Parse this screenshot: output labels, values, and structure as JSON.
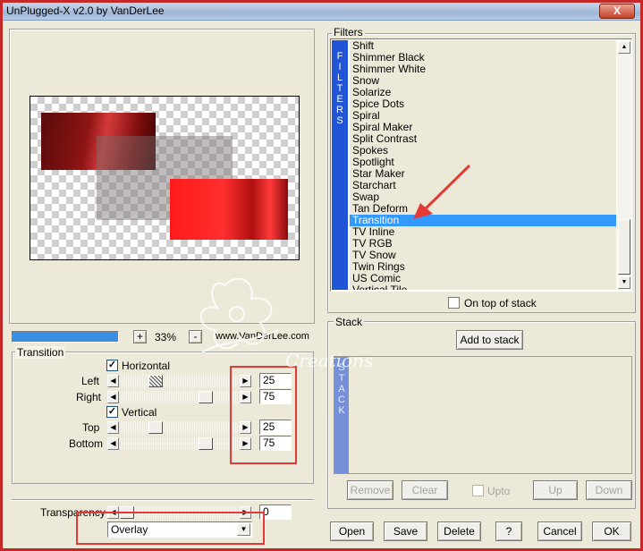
{
  "window": {
    "title": "UnPlugged-X v2.0 by VanDerLee",
    "close_label": "X"
  },
  "preview": {
    "progress": 1.0,
    "zoom_value": "33%",
    "plus_label": "+",
    "minus_label": "-",
    "website": "www.VanDerLee.com"
  },
  "filters": {
    "group_title": "Filters",
    "band_label": "FILTERS",
    "items": [
      "Shift",
      "Shimmer Black",
      "Shimmer White",
      "Snow",
      "Solarize",
      "Spice Dots",
      "Spiral",
      "Spiral Maker",
      "Split Contrast",
      "Spokes",
      "Spotlight",
      "Star Maker",
      "Starchart",
      "Swap",
      "Tan Deform",
      "Transition",
      "TV Inline",
      "TV RGB",
      "TV Snow",
      "Twin Rings",
      "US Comic",
      "Vertical Tile"
    ],
    "selected": "Transition",
    "on_top_label": "On top of stack"
  },
  "stack": {
    "group_title": "Stack",
    "add_label": "Add to stack",
    "band_label": "STACK",
    "remove_label": "Remove",
    "clear_label": "Clear",
    "upto_label": "Upto",
    "up_label": "Up",
    "down_label": "Down"
  },
  "transition": {
    "group_title": "Transition",
    "horizontal_label": "Horizontal",
    "vertical_label": "Vertical",
    "left_label": "Left",
    "left_value": "25",
    "right_label": "Right",
    "right_value": "75",
    "top_label": "Top",
    "top_value": "25",
    "bottom_label": "Bottom",
    "bottom_value": "75"
  },
  "transparency": {
    "label": "Transparency",
    "value": "0"
  },
  "blend_mode": {
    "value": "Overlay"
  },
  "buttons": {
    "open": "Open",
    "save": "Save",
    "delete": "Delete",
    "help": "?",
    "cancel": "Cancel",
    "ok": "OK"
  },
  "watermark": "Creations",
  "colors": {
    "accent_blue": "#2155d6",
    "selection_blue": "#3399ff",
    "highlight_red": "#e53935",
    "window_bg": "#ece9d8"
  }
}
